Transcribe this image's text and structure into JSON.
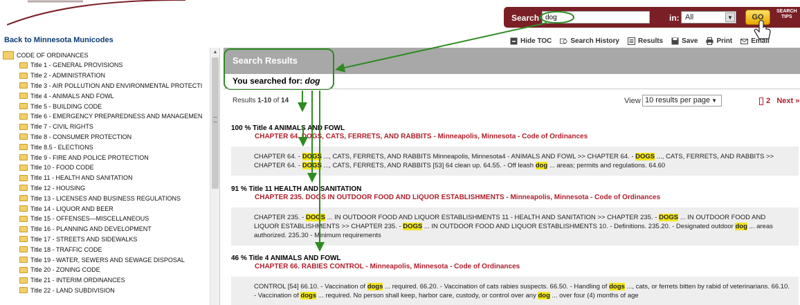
{
  "header": {
    "search_label": "Search",
    "search_value": "dog",
    "in_label": "in:",
    "scope_value": "All",
    "go_label": "GO",
    "tips_line1": "SEARCH",
    "tips_line2": "TIPS"
  },
  "back_link": "Back to Minnesota Municodes",
  "toolbar": {
    "hide_toc": "Hide TOC",
    "search_history": "Search History",
    "results": "Results",
    "save": "Save",
    "print": "Print",
    "email": "Email"
  },
  "sidebar": {
    "root": "CODE OF ORDINANCES",
    "items": [
      "Title 1 - GENERAL PROVISIONS",
      "Title 2 - ADMINISTRATION",
      "Title 3 - AIR POLLUTION AND ENVIRONMENTAL PROTECTI",
      "Title 4 - ANIMALS AND FOWL",
      "Title 5 - BUILDING CODE",
      "Title 6 - EMERGENCY PREPAREDNESS AND MANAGEMEN",
      "Title 7 - CIVIL RIGHTS",
      "Title 8 - CONSUMER PROTECTION",
      "Title 8.5 - ELECTIONS",
      "Title 9 - FIRE AND POLICE PROTECTION",
      "Title 10 - FOOD CODE",
      "Title 11 - HEALTH AND SANITATION",
      "Title 12 - HOUSING",
      "Title 13 - LICENSES AND BUSINESS REGULATIONS",
      "Title 14 - LIQUOR AND BEER",
      "Title 15 - OFFENSES—MISCELLANEOUS",
      "Title 16 - PLANNING AND DEVELOPMENT",
      "Title 17 - STREETS AND SIDEWALKS",
      "Title 18 - TRAFFIC CODE",
      "Title 19 - WATER, SEWERS AND SEWAGE DISPOSAL",
      "Title 20 - ZONING CODE",
      "Title 21 - INTERIM ORDINANCES",
      "Title 22 - LAND SUBDIVISION"
    ]
  },
  "main": {
    "heading": "Search Results",
    "searched_for_label": "You searched for:",
    "searched_term": "dog",
    "results_prefix": "Results ",
    "results_range": "1-10",
    "results_of": " of ",
    "results_total": "14",
    "view_label": "View",
    "per_page": "10 results per page",
    "page_next_number": "2",
    "next_label": "Next »"
  },
  "results": [
    {
      "score": "100 %",
      "title": "Title 4 ANIMALS AND FOWL",
      "link": "CHAPTER 64. DOGS, CATS, FERRETS, AND RABBITS - Minneapolis, Minnesota - Code of Ordinances",
      "snippet": "CHAPTER 64. - [[DOGS]] ..., CATS, FERRETS, AND RABBITS Minneapolis, Minnesota4 - ANIMALS AND FOWL >> CHAPTER 64. - [[DOGS]] ..., CATS, FERRETS, AND RABBITS >> CHAPTER 64. - [[DOGS]] ..., CATS, FERRETS, AND RABBITS [53] 64 clean up. 64.55. - Off leash [[dog]] ... areas; permits and regulations. 64.60"
    },
    {
      "score": "91 %",
      "title": "Title 11 HEALTH AND SANITATION",
      "link": "CHAPTER 235. DOGS IN OUTDOOR FOOD AND LIQUOR ESTABLISHMENTS - Minneapolis, Minnesota - Code of Ordinances",
      "snippet": "CHAPTER 235. - [[DOGS]] ... IN OUTDOOR FOOD AND LIQUOR ESTABLISHMENTS 11 - HEALTH AND SANITATION >> CHAPTER 235. - [[DOGS]] ... IN OUTDOOR FOOD AND LIQUOR ESTABLISHMENTS >> CHAPTER 235. - [[DOGS]] ... IN OUTDOOR FOOD AND LIQUOR ESTABLISHMENTS 10. - Definitions. 235.20. - Designated outdoor [[dog]] ... areas authorized. 235.30 - Minimum requirements"
    },
    {
      "score": "46 %",
      "title": "Title 4 ANIMALS AND FOWL",
      "link": "CHAPTER 66. RABIES CONTROL - Minneapolis, Minnesota - Code of Ordinances",
      "snippet": "CONTROL [54] 66.10. - Vaccination of [[dogs]] ... required. 66.20. - Vaccination of cats rabies suspects. 66.50. - Handling of [[dogs]] ..., cats, or ferrets bitten by rabid of veterinarians. 66.10. - Vaccination of [[dogs]] ... required. No person shall keep, harbor care, custody, or control over any [[dog]] ... over four (4) months of age"
    }
  ],
  "colors": {
    "header_maroon": "#7a1f25",
    "link_red": "#b01e2b",
    "highlight_yellow": "#f2e51d",
    "annotation_green": "#2e8b22",
    "results_band_gray": "#a8a8a8"
  }
}
